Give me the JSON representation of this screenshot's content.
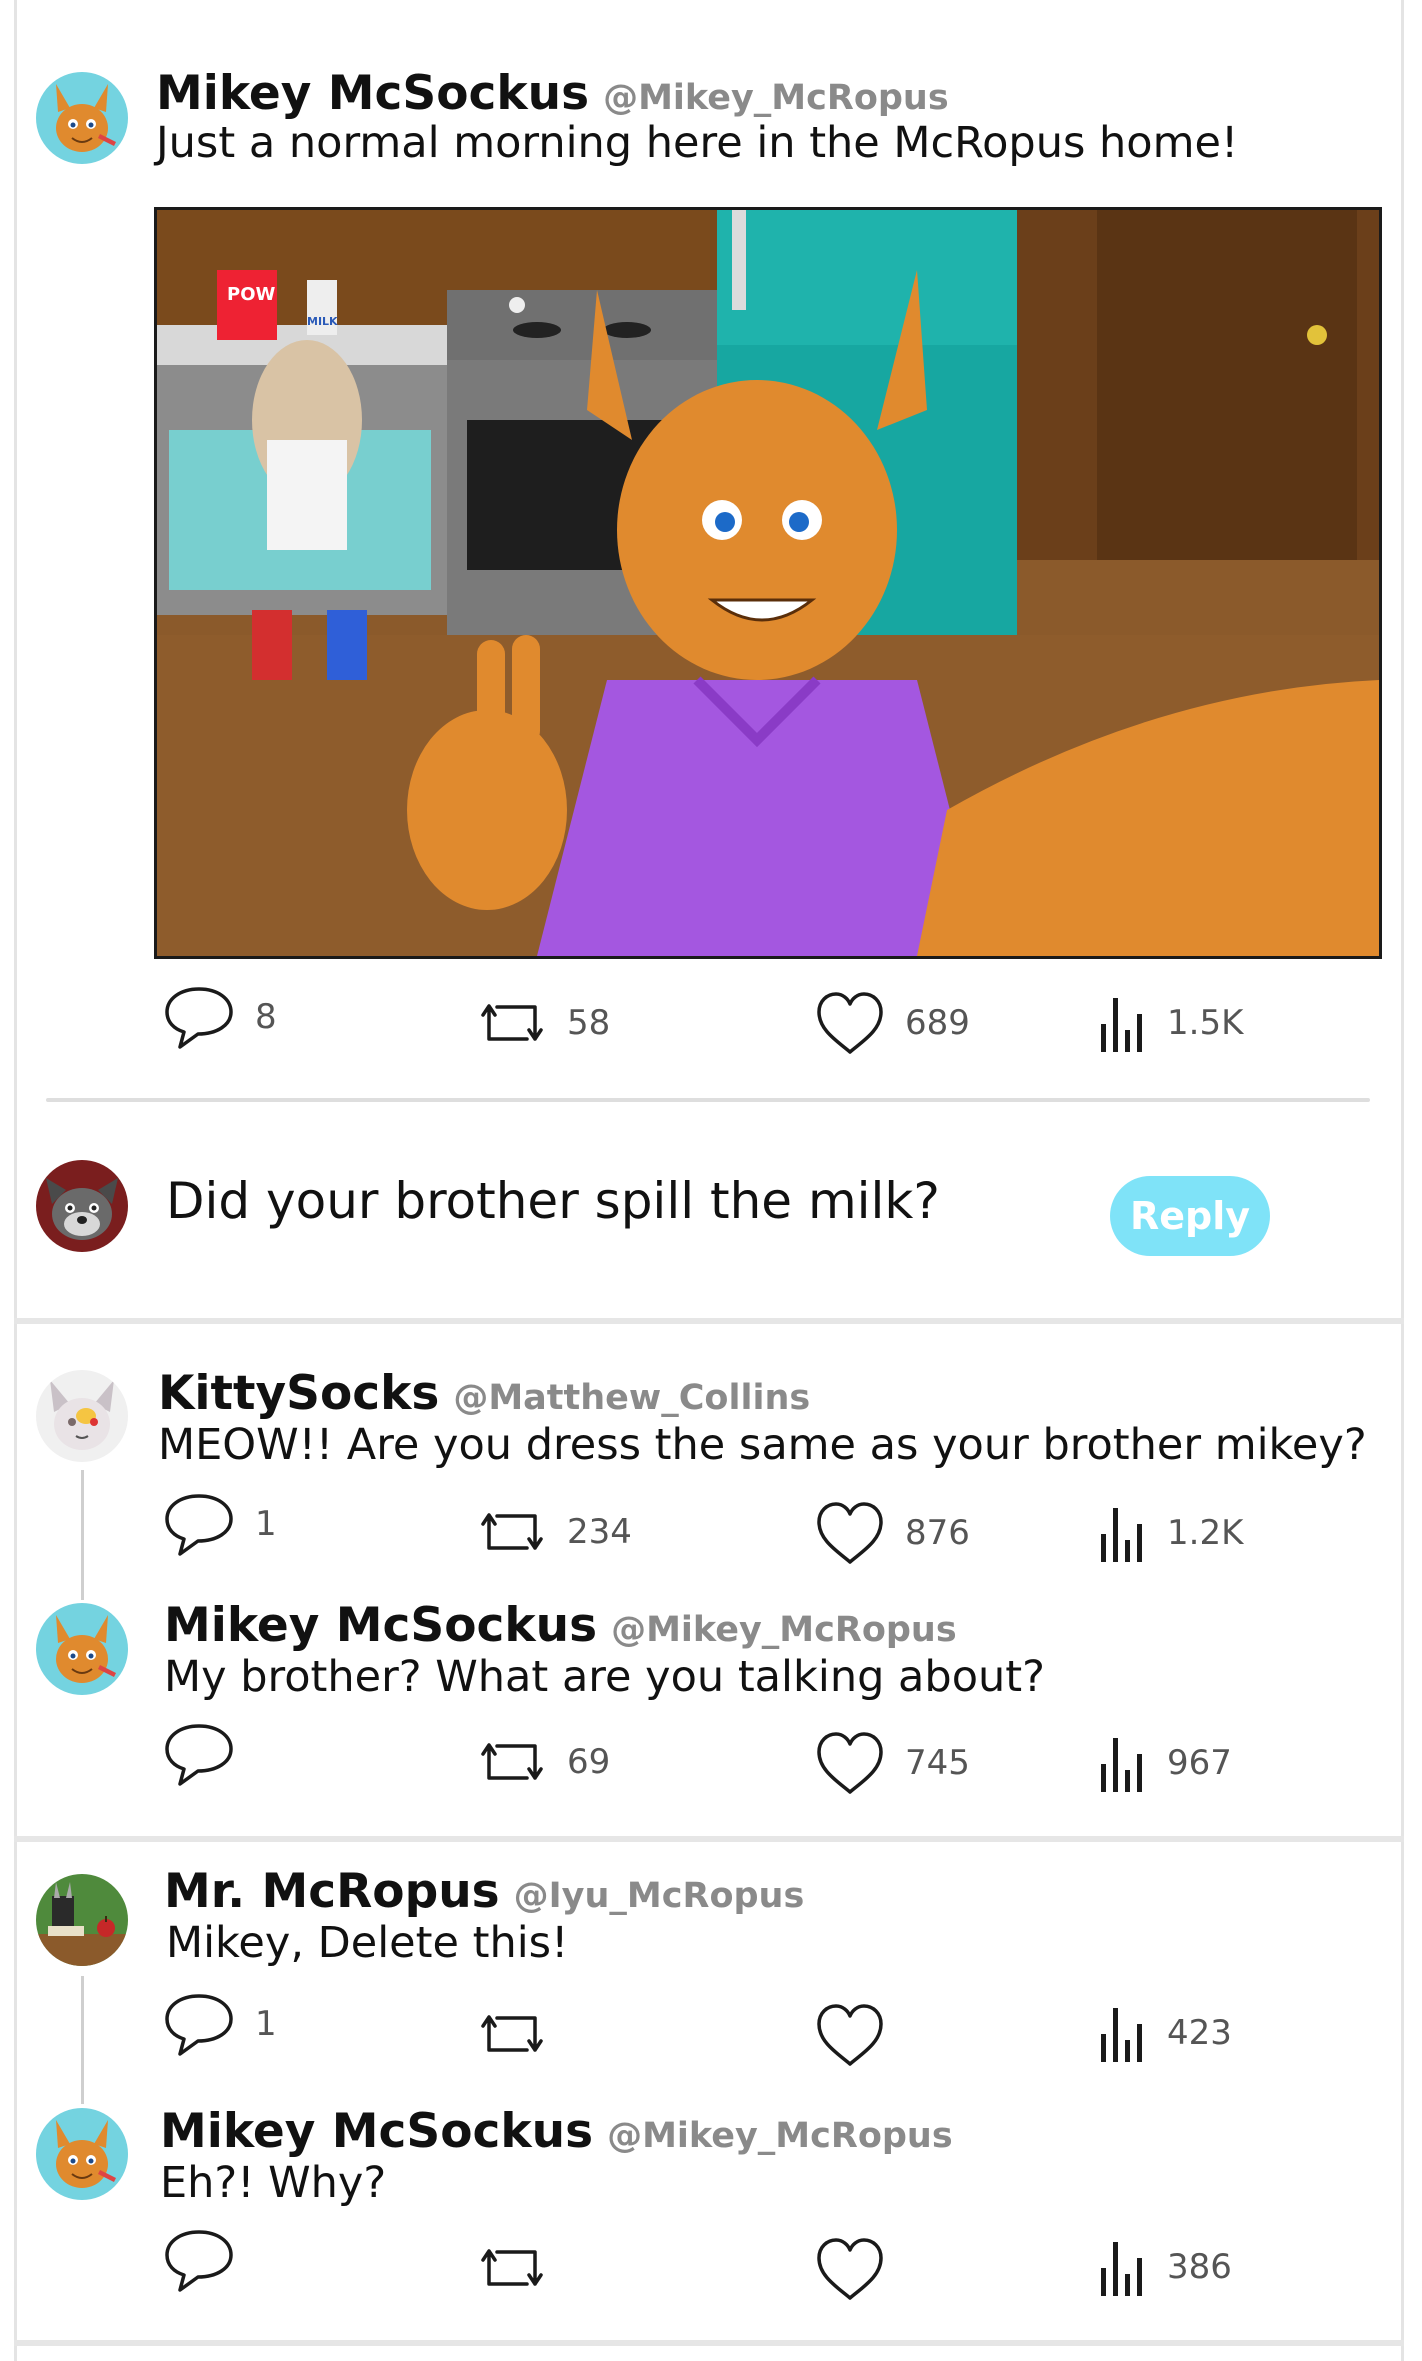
{
  "main_post": {
    "author": "Mikey McSockus",
    "handle": "@Mikey_McRopus",
    "text": "Just a normal morning here in the McRopus home!",
    "media_label": "POW",
    "milk_label": "MILK",
    "stats": {
      "replies": "8",
      "reposts": "58",
      "likes": "689",
      "views": "1.5K"
    }
  },
  "composer": {
    "text": "Did your brother spill the milk?",
    "button": "Reply"
  },
  "threads": [
    [
      {
        "author": "KittySocks",
        "handle": "@Matthew_Collins",
        "text": "MEOW!! Are you dress the same as your brother mikey?",
        "stats": {
          "replies": "1",
          "reposts": "234",
          "likes": "876",
          "views": "1.2K"
        }
      },
      {
        "author": "Mikey McSockus",
        "handle": "@Mikey_McRopus",
        "text": "My brother? What are you talking about?",
        "stats": {
          "replies": "",
          "reposts": "69",
          "likes": "745",
          "views": "967"
        }
      }
    ],
    [
      {
        "author": "Mr. McRopus",
        "handle": "@Iyu_McRopus",
        "text": "Mikey, Delete this!",
        "stats": {
          "replies": "1",
          "reposts": "",
          "likes": "",
          "views": "423"
        }
      },
      {
        "author": "Mikey McSockus",
        "handle": "@Mikey_McRopus",
        "text": "Eh?! Why?",
        "stats": {
          "replies": "",
          "reposts": "",
          "likes": "",
          "views": "386"
        }
      }
    ]
  ],
  "icons": {
    "reply": "speech-bubble-icon",
    "repost": "repost-icon",
    "like": "heart-icon",
    "views": "bar-chart-icon"
  },
  "colors": {
    "reply_button": "#7fe3f8",
    "handle": "#8a8a8a",
    "separator": "#e6e6e6"
  }
}
